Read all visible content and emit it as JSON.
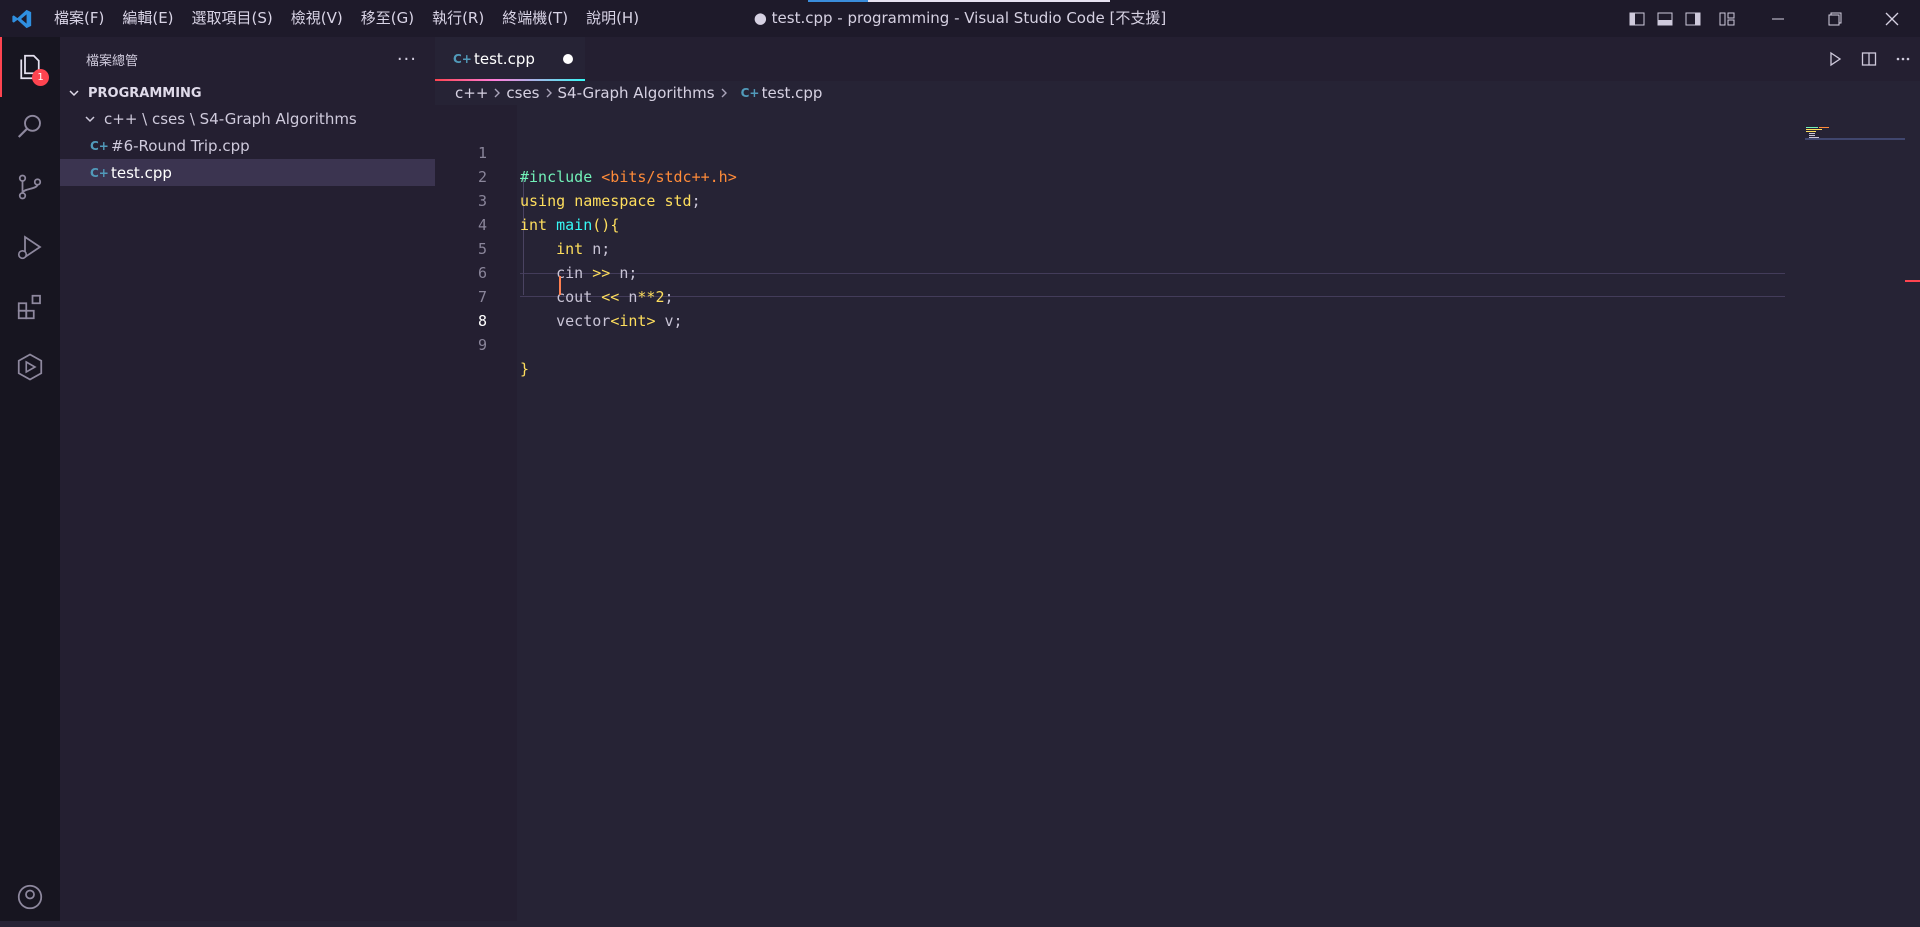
{
  "titlebar": {
    "menus": [
      "檔案(F)",
      "編輯(E)",
      "選取項目(S)",
      "檢視(V)",
      "移至(G)",
      "執行(R)",
      "終端機(T)",
      "說明(H)"
    ],
    "title": "● test.cpp - programming - Visual Studio Code [不支援]"
  },
  "activitybar": {
    "explorer_badge": "1"
  },
  "sidebar": {
    "title": "檔案總管",
    "more": "···",
    "section": "PROGRAMMING",
    "folder": "c++ \\ cses \\ S4-Graph Algorithms",
    "files": [
      "#6-Round Trip.cpp",
      "test.cpp"
    ]
  },
  "editor": {
    "tab_label": "test.cpp",
    "breadcrumb": [
      "c++",
      "cses",
      "S4-Graph Algorithms",
      "test.cpp"
    ],
    "line_numbers": [
      "1",
      "2",
      "3",
      "4",
      "5",
      "6",
      "7",
      "8",
      "9"
    ],
    "code": {
      "l1_include": "#include",
      "l1_header": "<bits/stdc++.h>",
      "l2_using": "using",
      "l2_namespace": "namespace",
      "l2_std": "std",
      "l2_semi": ";",
      "l3_int": "int",
      "l3_main": "main",
      "l3_parens": "()",
      "l3_brace": "{",
      "l4_int": "int",
      "l4_rest": " n;",
      "l5_cin": "cin",
      "l5_op": ">>",
      "l5_rest": " n;",
      "l6_cout": "cout",
      "l6_op": "<<",
      "l6_n": " n",
      "l6_pow": "**",
      "l6_two": "2",
      "l6_semi": ";",
      "l7_vector": "vector",
      "l7_lt": "<",
      "l7_int": "int",
      "l7_gt": ">",
      "l7_rest": " v;",
      "l9_brace": "}"
    }
  },
  "colors": {
    "accent": "#fe4450",
    "keyword": "#fede5d",
    "include": "#72f1b8",
    "string": "#ff8b39",
    "function": "#36f9f6"
  }
}
